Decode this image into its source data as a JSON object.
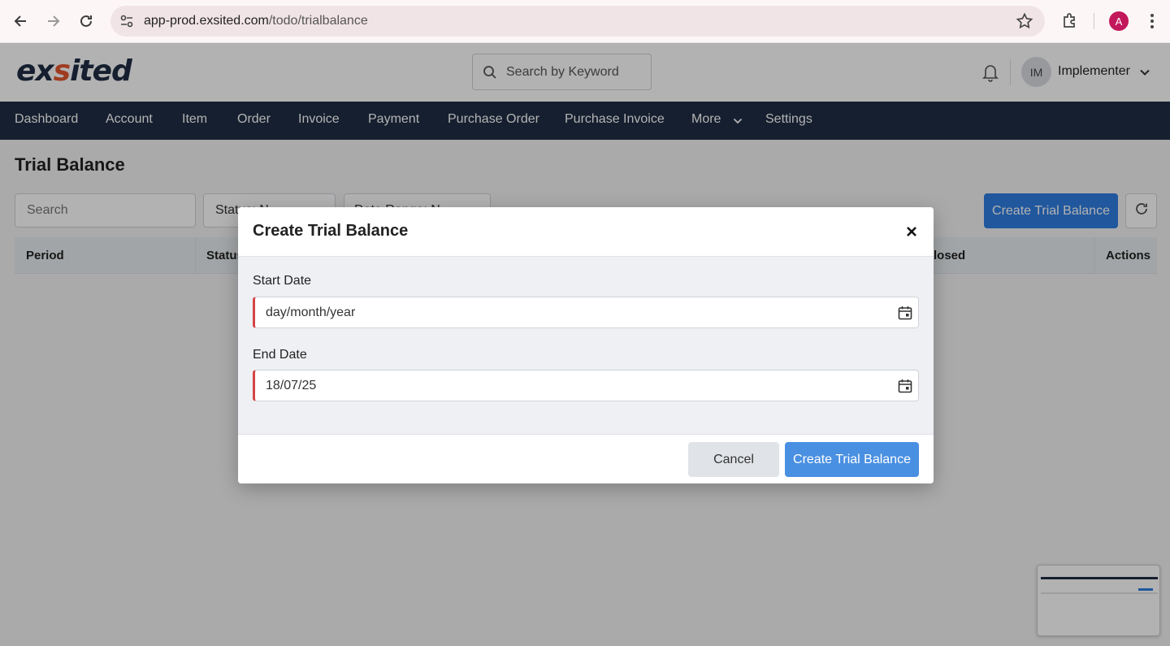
{
  "browser": {
    "url_host": "app-prod.exsited.com",
    "url_path": "/todo/trialbalance",
    "profile_initial": "A"
  },
  "header": {
    "logo_prefix": "ex",
    "logo_mark": "s",
    "logo_suffix": "ited",
    "search_placeholder": "Search by Keyword",
    "avatar_initials": "IM",
    "user_name": "Implementer"
  },
  "nav": {
    "items": [
      "Dashboard",
      "Account",
      "Item",
      "Order",
      "Invoice",
      "Payment",
      "Purchase Order",
      "Purchase Invoice",
      "More",
      "Settings"
    ]
  },
  "page": {
    "title": "Trial Balance",
    "search_placeholder": "Search",
    "status_filter": "Status: N",
    "date_filter": "Date Range: N",
    "create_button": "Create Trial Balance",
    "columns": [
      "Period",
      "Status",
      "losed",
      "Actions"
    ]
  },
  "modal": {
    "title": "Create Trial Balance",
    "start_label": "Start Date",
    "start_value": "day/month/year",
    "end_label": "End Date",
    "end_value": "18/07/25",
    "cancel": "Cancel",
    "submit": "Create Trial Balance"
  },
  "colors": {
    "nav_bg": "#1f2d44",
    "primary": "#2f7de1",
    "required_border": "#d64545"
  }
}
